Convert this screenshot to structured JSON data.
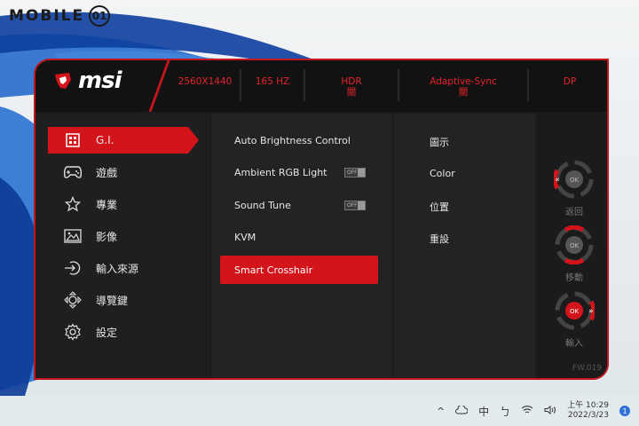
{
  "watermark": {
    "text": "MOBILE",
    "glyph": "01"
  },
  "header": {
    "brand": "msi",
    "specs": [
      {
        "top": "2560X1440",
        "bottom": ""
      },
      {
        "top": "165 HZ",
        "bottom": ""
      },
      {
        "top": "HDR",
        "bottom": "關"
      },
      {
        "top": "Adaptive-Sync",
        "bottom": "關"
      },
      {
        "top": "DP",
        "bottom": ""
      }
    ]
  },
  "sidebar": {
    "items": [
      {
        "label": "G.I.",
        "icon": "gi-icon"
      },
      {
        "label": "遊戲",
        "icon": "gamepad-icon"
      },
      {
        "label": "專業",
        "icon": "star-icon"
      },
      {
        "label": "影像",
        "icon": "image-icon"
      },
      {
        "label": "輸入來源",
        "icon": "input-icon"
      },
      {
        "label": "導覽鍵",
        "icon": "navigation-key-icon"
      },
      {
        "label": "設定",
        "icon": "gear-icon"
      }
    ]
  },
  "middle": {
    "items": [
      {
        "label": "Auto Brightness Control"
      },
      {
        "label": "Ambient RGB Light",
        "toggle": "OFF"
      },
      {
        "label": "Sound Tune",
        "toggle": "OFF"
      },
      {
        "label": "KVM"
      },
      {
        "label": "Smart Crosshair"
      }
    ]
  },
  "right": {
    "items": [
      "圖示",
      "Color",
      "位置",
      "重設"
    ]
  },
  "controls": {
    "back_label": "返回",
    "move_label": "移動",
    "enter_label": "輸入",
    "ok_text": "OK",
    "firmware": "FW.019"
  },
  "taskbar": {
    "ime": "中",
    "time": "上午 10:29",
    "date": "2022/3/23",
    "notification_count": "1"
  },
  "colors": {
    "accent": "#d4141b",
    "panel": "#1c1c1e"
  }
}
